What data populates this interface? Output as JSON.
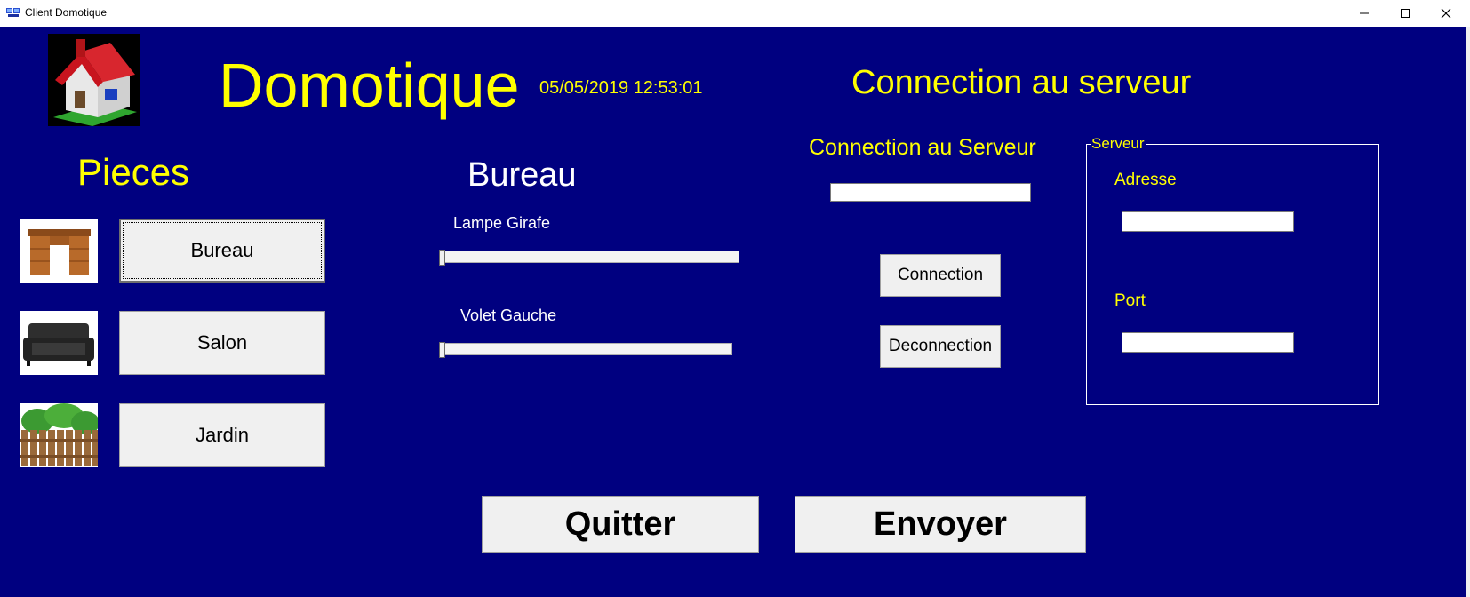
{
  "window": {
    "title": "Client Domotique",
    "controls": [
      "minimize-icon",
      "maximize-icon",
      "close-icon"
    ]
  },
  "header": {
    "title": "Domotique",
    "datetime": "05/05/2019 12:53:01",
    "server_title": "Connection au serveur"
  },
  "rooms": {
    "heading": "Pieces",
    "items": [
      {
        "label": "Bureau",
        "icon": "desk-icon"
      },
      {
        "label": "Salon",
        "icon": "sofa-icon"
      },
      {
        "label": "Jardin",
        "icon": "garden-fence-icon"
      }
    ]
  },
  "selected_room": {
    "title": "Bureau",
    "controls": [
      {
        "label": "Lampe Girafe",
        "value": 0
      },
      {
        "label": "Volet Gauche",
        "value": 0
      }
    ]
  },
  "connection": {
    "label": "Connection au Serveur",
    "status_value": "",
    "connect_label": "Connection",
    "disconnect_label": "Deconnection"
  },
  "server": {
    "group_label": "Serveur",
    "address_label": "Adresse",
    "address_value": "",
    "port_label": "Port",
    "port_value": ""
  },
  "actions": {
    "quit_label": "Quitter",
    "send_label": "Envoyer"
  },
  "colors": {
    "background": "#000080",
    "accent_text": "#ffff00",
    "label_text": "#ffffff",
    "button_face": "#f0f0f0"
  }
}
